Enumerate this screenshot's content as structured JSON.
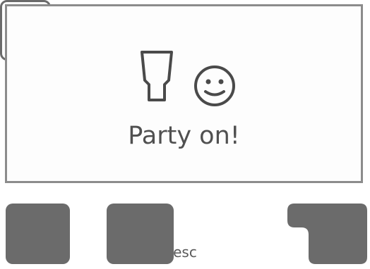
{
  "display": {
    "message": "Party on!",
    "icons": [
      "glass-icon",
      "smiley-icon"
    ]
  },
  "keys": {
    "esc_label": "esc"
  },
  "colors": {
    "frame": "#8c8c8c",
    "key": "#6b6b6b",
    "text": "#505050"
  }
}
